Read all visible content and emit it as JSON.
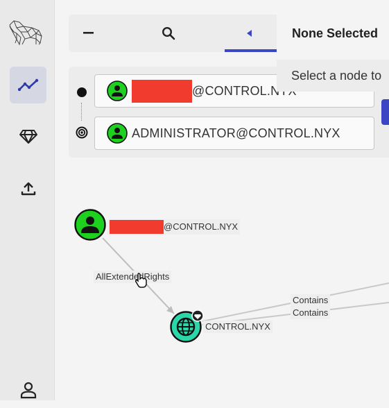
{
  "nav": {
    "items": [
      {
        "name": "pathfinding",
        "icon": "trending-icon",
        "active": true
      },
      {
        "name": "group-management",
        "icon": "diamond-icon",
        "active": false
      },
      {
        "name": "upload",
        "icon": "upload-icon",
        "active": false
      },
      {
        "name": "profile",
        "icon": "person-icon",
        "active": false
      }
    ]
  },
  "toolbar": {
    "tools": [
      {
        "icon": "minus-icon"
      },
      {
        "icon": "search-icon"
      },
      {
        "icon": "pathfinding-icon"
      }
    ]
  },
  "query": {
    "start_suffix": "@CONTROL.NYX",
    "end_value": "ADMINISTRATOR@CONTROL.NYX"
  },
  "info_panel": {
    "title": "None Selected",
    "hint": "Select a node to"
  },
  "graph": {
    "nodes": [
      {
        "id": "user",
        "label_suffix": "@CONTROL.NYX",
        "type": "user"
      },
      {
        "id": "domain",
        "label": "CONTROL.NYX",
        "type": "domain"
      }
    ],
    "edges": [
      {
        "label": "AllExtendedRights"
      },
      {
        "label": "Contains"
      },
      {
        "label": "Contains"
      }
    ]
  },
  "colors": {
    "accent": "#3b46c4",
    "user_node": "#1fd11f",
    "domain_node": "#2bd6a8",
    "redaction": "#f13b2e"
  }
}
